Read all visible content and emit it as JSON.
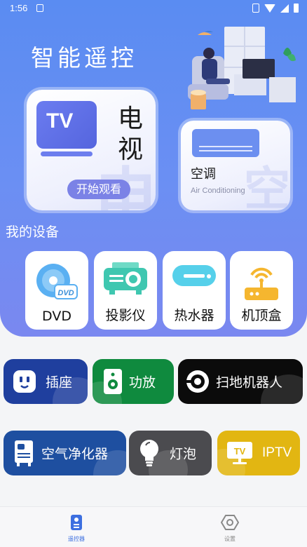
{
  "status_bar": {
    "time": "1:56"
  },
  "app": {
    "title": "智能遥控"
  },
  "tv_card": {
    "label": "电视",
    "watermark": "电",
    "icon_text": "TV",
    "action": "开始观看"
  },
  "ac_card": {
    "name": "空调",
    "subtitle": "Air Conditioning",
    "watermark": "空"
  },
  "my_devices": {
    "title": "我的设备",
    "items": [
      {
        "label": "DVD",
        "icon": "dvd-icon"
      },
      {
        "label": "投影仪",
        "icon": "projector-icon"
      },
      {
        "label": "热水器",
        "icon": "water-heater-icon"
      },
      {
        "label": "机顶盒",
        "icon": "set-top-box-icon"
      }
    ]
  },
  "quick_devices": {
    "row1": [
      {
        "label": "插座",
        "icon": "socket-icon",
        "color": "#1f3f9e"
      },
      {
        "label": "功放",
        "icon": "amplifier-icon",
        "color": "#0f8a3e"
      },
      {
        "label": "扫地机器人",
        "icon": "robot-vacuum-icon",
        "color": "#0b0b0b"
      }
    ],
    "row2": [
      {
        "label": "空气净化器",
        "icon": "air-purifier-icon",
        "color": "#1e4fa0"
      },
      {
        "label": "灯泡",
        "icon": "bulb-icon",
        "color": "#4b4b4f"
      },
      {
        "label": "IPTV",
        "icon": "iptv-icon",
        "color": "#e2b612"
      }
    ]
  },
  "bottom_nav": {
    "items": [
      {
        "label": "遥控器",
        "icon": "remote-icon",
        "active": true
      },
      {
        "label": "设置",
        "icon": "settings-icon",
        "active": false
      }
    ],
    "active_color": "#3d6fe0",
    "inactive_color": "#888888"
  }
}
